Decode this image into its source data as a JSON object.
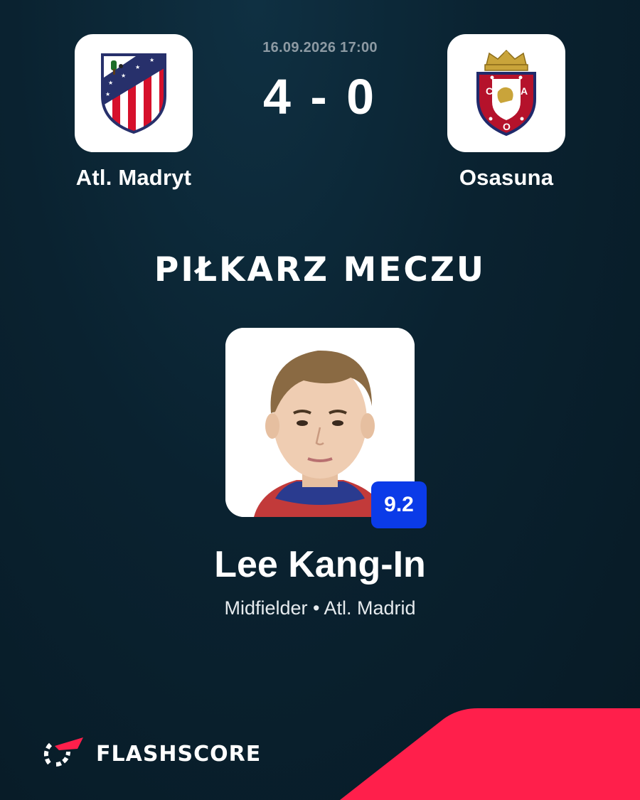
{
  "match": {
    "datetime": "16.09.2026 17:00",
    "home_team": "Atl. Madryt",
    "away_team": "Osasuna",
    "home_score": "4",
    "away_score": "0",
    "score_separator": "-"
  },
  "section_title": "PIŁKARZ MECZU",
  "player": {
    "name": "Lee Kang-In",
    "rating": "9.2",
    "position": "Midfielder",
    "club": "Atl. Madrid",
    "separator": "•"
  },
  "brand": {
    "name": "FLASHSCORE"
  },
  "icons": {
    "home_logo": "atletico-madrid-crest-icon",
    "away_logo": "osasuna-crest-icon",
    "brand_logo": "flashscore-logo-icon",
    "away_crest_letters": [
      "C",
      "A",
      "O"
    ]
  },
  "colors": {
    "accent_red": "#ff1f4b",
    "rating_blue": "#0b3be8",
    "background": "#0a2230"
  }
}
